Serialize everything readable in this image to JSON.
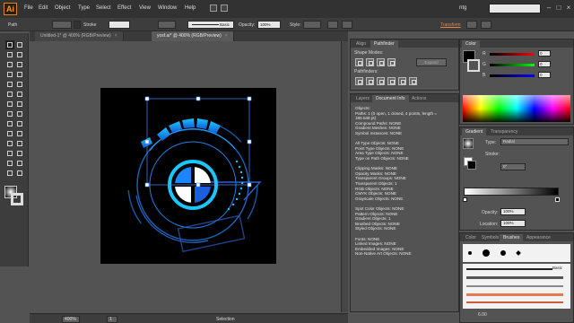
{
  "app": {
    "logo_text": "Ai"
  },
  "menu": [
    "File",
    "Edit",
    "Object",
    "Type",
    "Select",
    "Effect",
    "View",
    "Window",
    "Help"
  ],
  "workspace": {
    "label": "ntg"
  },
  "control_bar": {
    "path_label": "Path",
    "stroke_label": "Stroke",
    "brush_label": "Basic",
    "opacity_label": "Opacity:",
    "opacity_value": "100%",
    "style_label": "Style:",
    "transform_label": "Transform"
  },
  "doc_tabs": [
    {
      "label": "Untitled-1* @ 400% (RGB/Preview)",
      "close": "×"
    },
    {
      "label": "yosf.ai* @ 400% (RGB/Preview)",
      "close": "×"
    }
  ],
  "status_bar": {
    "zoom": "400%",
    "page": "1",
    "tool_status": "Selection"
  },
  "align_panel": {
    "tabs": [
      "Align",
      "Pathfinder"
    ],
    "shape_modes_label": "Shape Modes:",
    "expand_label": "Expand",
    "pathfinders_label": "Pathfinders:"
  },
  "doc_info_panel": {
    "tabs": [
      "Layers",
      "Document Info",
      "Actions"
    ],
    "lines": [
      "Objects:",
      "Paths: 1 (0 open, 1 closed, 4 points, length =",
      "185.548 pt)",
      "Compound Paths: NONE",
      "Gradient Meshes: NONE",
      "Symbol Instances: NONE",
      "",
      "All Type Objects: NONE",
      "Point Type Objects: NONE",
      "Area Type Objects: NONE",
      "Type on Path Objects: NONE",
      "",
      "Clipping Masks: NONE",
      "Opacity Masks: NONE",
      "Transparent Groups: NONE",
      "Transparent Objects: 1",
      "RGB Objects: NONE",
      "CMYK Objects: NONE",
      "Grayscale Objects: NONE",
      "",
      "Spot Color Objects: NONE",
      "Pattern Objects: NONE",
      "Gradient Objects: 1",
      "Brushed Objects: NONE",
      "Styled Objects: NONE",
      "",
      "Fonts: NONE",
      "Linked Images: NONE",
      "Embedded Images: NONE",
      "Non-Native Art Objects: NONE"
    ]
  },
  "color_panel": {
    "title": "Color",
    "r": "0",
    "g": "0",
    "b": "0"
  },
  "gradient_panel": {
    "tabs": [
      "Gradient",
      "Transparency"
    ],
    "type_label": "Type:",
    "type_value": "Radial",
    "stroke_label": "Stroke:",
    "angle_value": "0°",
    "opacity_label": "Opacity:",
    "opacity_value": "100%",
    "location_label": "Location:",
    "location_value": "100%"
  },
  "brushes_panel": {
    "tabs": [
      "Color",
      "Symbols",
      "Brushes",
      "Appearance"
    ],
    "basic_label": "Basic",
    "size_value": "6.00"
  },
  "colors": {
    "accent": "#ff9a1a",
    "artwork_blue": "#1e90ff",
    "artwork_cyan": "#19c6ff",
    "selection": "#4a90ff"
  }
}
